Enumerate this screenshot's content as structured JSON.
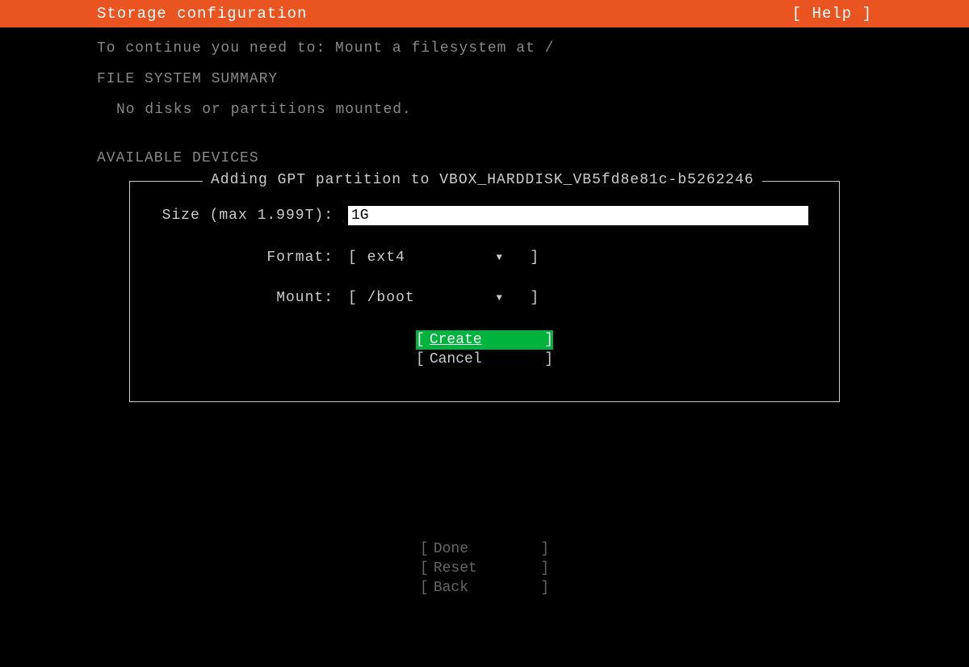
{
  "header": {
    "title": "Storage configuration",
    "help": "[ Help ]"
  },
  "info": {
    "continue_message": "To continue you need to: Mount a filesystem at /"
  },
  "sections": {
    "filesystem_summary_heading": "FILE SYSTEM SUMMARY",
    "filesystem_summary_text": "No disks or partitions mounted.",
    "available_devices_heading": "AVAILABLE DEVICES"
  },
  "dialog": {
    "title": "Adding GPT partition to VBOX_HARDDISK_VB5fd8e81c-b5262246",
    "size": {
      "label": "Size (max 1.999T):",
      "value": "1G"
    },
    "format": {
      "label": "Format:",
      "value": "ext4"
    },
    "mount": {
      "label": "Mount:",
      "value": "/boot"
    },
    "buttons": {
      "create": "Create",
      "cancel": "Cancel"
    }
  },
  "footer": {
    "done": "Done",
    "reset": "Reset",
    "back": "Back"
  }
}
